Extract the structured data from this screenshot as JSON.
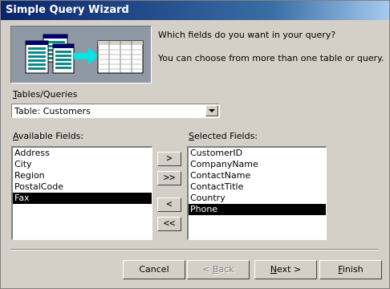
{
  "window": {
    "title": "Simple Query Wizard"
  },
  "prompt": {
    "line1": "Which fields do you want in your query?",
    "line2": "You can choose from more than one table or query."
  },
  "tables": {
    "label_prefix": "",
    "label_underlined": "T",
    "label_rest": "ables/Queries",
    "selected": "Table: Customers"
  },
  "available": {
    "label_underlined": "A",
    "label_rest": "vailable Fields:",
    "items": [
      "Address",
      "City",
      "Region",
      "PostalCode",
      "Fax"
    ],
    "selected_index": 4
  },
  "selected_fields": {
    "label_underlined": "S",
    "label_rest": "elected Fields:",
    "items": [
      "CustomerID",
      "CompanyName",
      "ContactName",
      "ContactTitle",
      "Country",
      "Phone"
    ],
    "selected_index": 5
  },
  "move_buttons": {
    "add_one": ">",
    "add_all": ">>",
    "remove_one": "<",
    "remove_all": "<<"
  },
  "buttons": {
    "cancel": "Cancel",
    "back_prefix": "< ",
    "back_underlined": "B",
    "back_rest": "ack",
    "next_underlined": "N",
    "next_rest": "ext >",
    "finish_underlined": "F",
    "finish_rest": "inish"
  }
}
